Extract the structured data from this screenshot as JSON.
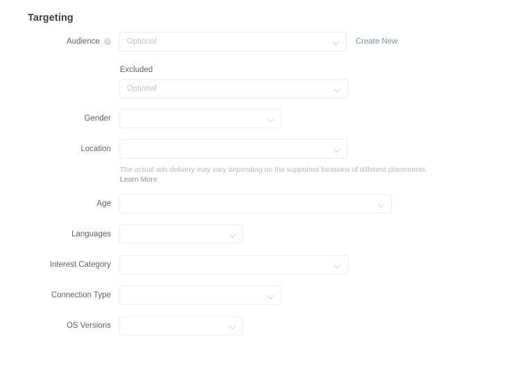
{
  "section": {
    "title": "Targeting"
  },
  "colors": {
    "background": "#ffffff",
    "heading_text": "#3c4043",
    "label_text": "#5f6368",
    "placeholder_text": "#c3c6cc",
    "field_border": "#ebedf0",
    "link": "#8593ad",
    "helper_text": "#b6bac1",
    "chevron": "#cfd3d9",
    "info_icon": "#d6d9de"
  },
  "fields": {
    "audience": {
      "label": "Audience",
      "info_icon": "info-circle-icon",
      "placeholder": "Optional",
      "chevron": "chevron-down-icon",
      "action_link": "Create New"
    },
    "excluded": {
      "label": "Excluded",
      "placeholder": "Optional",
      "chevron": "chevron-down-icon"
    },
    "gender": {
      "label": "Gender",
      "value": "",
      "chevron": "chevron-down-icon"
    },
    "location": {
      "label": "Location",
      "value": "",
      "chevron": "chevron-down-icon",
      "helper_text": "The actual ads delivery may vary depending on the supported locations of different placements.",
      "helper_link": "Learn More"
    },
    "age": {
      "label": "Age",
      "value": "",
      "chevron": "chevron-down-icon"
    },
    "languages": {
      "label": "Languages",
      "value": "",
      "chevron": "chevron-down-icon"
    },
    "interest_category": {
      "label": "Interest Category",
      "value": "",
      "chevron": "chevron-down-icon"
    },
    "connection_type": {
      "label": "Connection Type",
      "value": "",
      "chevron": "chevron-down-icon"
    },
    "os_versions": {
      "label": "OS Versions",
      "value": "",
      "chevron": "chevron-down-icon"
    }
  }
}
